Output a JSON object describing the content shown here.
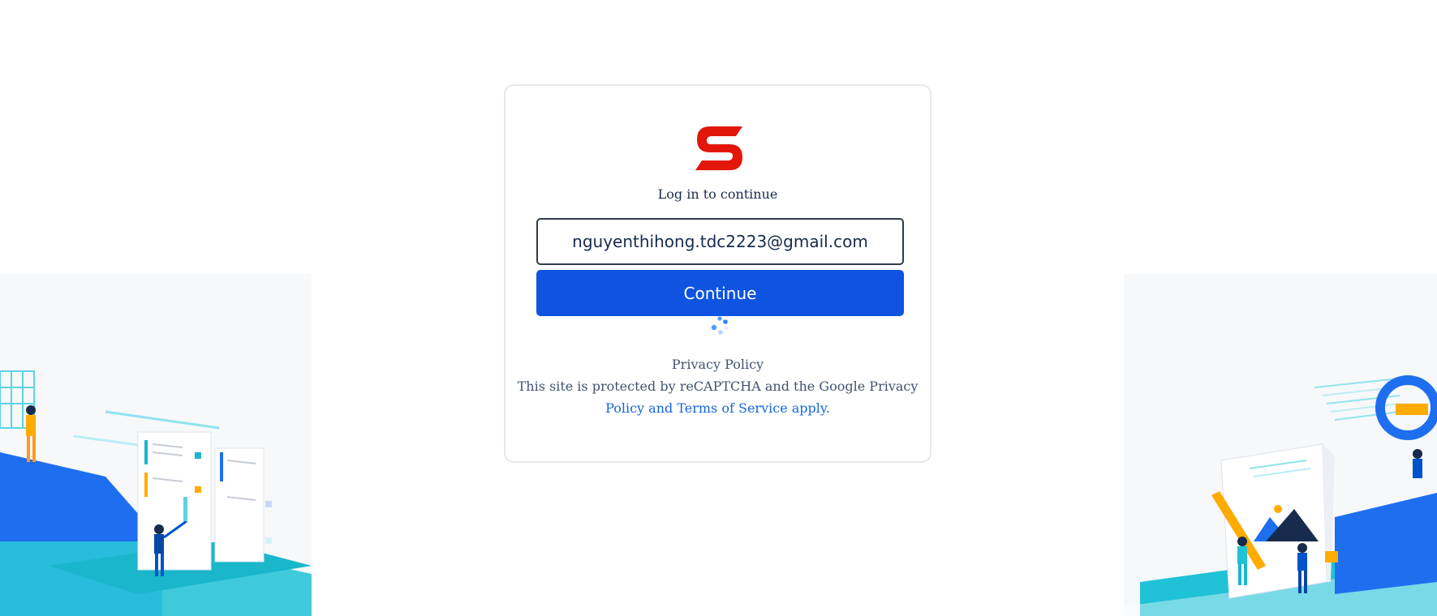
{
  "login": {
    "subtitle": "Log in to continue",
    "email_value": "nguyenthihong.tdc2223@gmail.com",
    "continue_label": "Continue",
    "brand_color": "#e3160b",
    "button_color": "#0f54e0"
  },
  "footer": {
    "privacy_policy": "Privacy Policy",
    "recaptcha_line": "This site is protected by reCAPTCHA and the Google Privacy",
    "terms_link": "Policy and Terms of Service apply."
  },
  "icons": {
    "logo": "brand-s-logo",
    "spinner": "loading-spinner",
    "left_illustration": "team-building-illustration",
    "right_illustration": "team-creating-illustration"
  }
}
